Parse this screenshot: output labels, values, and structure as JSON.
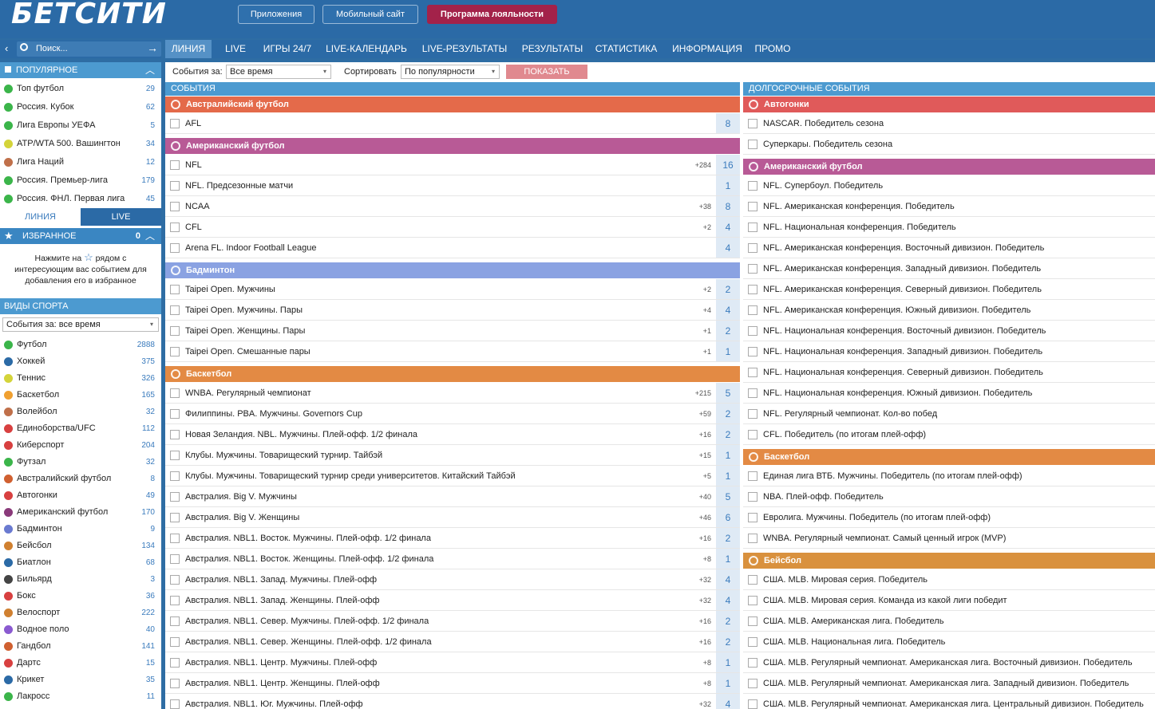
{
  "header": {
    "logo": "БЕТСИТИ",
    "buttons": [
      "Приложения",
      "Мобильный сайт",
      "Программа лояльности"
    ]
  },
  "nav": {
    "tabs": [
      "ЛИНИЯ",
      "LIVE",
      "ИГРЫ 24/7",
      "LIVE-КАЛЕНДАРЬ",
      "LIVE-РЕЗУЛЬТАТЫ",
      "РЕЗУЛЬТАТЫ",
      "СТАТИСТИКА",
      "ИНФОРМАЦИЯ",
      "ПРОМО"
    ]
  },
  "search": {
    "placeholder": "Поиск..."
  },
  "popular": {
    "title": "ПОПУЛЯРНОЕ",
    "items": [
      {
        "label": "Топ футбол",
        "count": "29",
        "color": "#3bb54a"
      },
      {
        "label": "Россия. Кубок",
        "count": "62",
        "color": "#3bb54a"
      },
      {
        "label": "Лига Европы УЕФА",
        "count": "5",
        "color": "#3bb54a"
      },
      {
        "label": "ATP/WTA 500. Вашингтон",
        "count": "34",
        "color": "#d4d43a"
      },
      {
        "label": "Лига Наций",
        "count": "12",
        "color": "#c0704a"
      },
      {
        "label": "Россия. Премьер-лига",
        "count": "179",
        "color": "#3bb54a"
      },
      {
        "label": "Россия. ФНЛ. Первая лига",
        "count": "45",
        "color": "#3bb54a"
      }
    ]
  },
  "side_tabs": [
    "ЛИНИЯ",
    "LIVE"
  ],
  "favorites": {
    "title": "ИЗБРАННОЕ",
    "count": "0",
    "hint_a": "Нажмите на",
    "hint_b": "рядом с",
    "hint_c": "интересующим вас событием для",
    "hint_d": "добавления его в избранное"
  },
  "sports": {
    "title": "ВИДЫ СПОРТА",
    "filter": "События за: все время",
    "items": [
      {
        "label": "Футбол",
        "count": "2888",
        "color": "#3bb54a"
      },
      {
        "label": "Хоккей",
        "count": "375",
        "color": "#2b6aa6"
      },
      {
        "label": "Теннис",
        "count": "326",
        "color": "#d4d43a"
      },
      {
        "label": "Баскетбол",
        "count": "165",
        "color": "#f0a030"
      },
      {
        "label": "Волейбол",
        "count": "32",
        "color": "#c0704a"
      },
      {
        "label": "Единоборства/UFC",
        "count": "112",
        "color": "#d84040"
      },
      {
        "label": "Киберспорт",
        "count": "204",
        "color": "#d84040"
      },
      {
        "label": "Футзал",
        "count": "32",
        "color": "#3bb54a"
      },
      {
        "label": "Австралийский футбол",
        "count": "8",
        "color": "#d06030"
      },
      {
        "label": "Автогонки",
        "count": "49",
        "color": "#d84040"
      },
      {
        "label": "Американский футбол",
        "count": "170",
        "color": "#8a3a7a"
      },
      {
        "label": "Бадминтон",
        "count": "9",
        "color": "#6a7ad0"
      },
      {
        "label": "Бейсбол",
        "count": "134",
        "color": "#d08030"
      },
      {
        "label": "Биатлон",
        "count": "68",
        "color": "#2b6aa6"
      },
      {
        "label": "Бильярд",
        "count": "3",
        "color": "#444444"
      },
      {
        "label": "Бокс",
        "count": "36",
        "color": "#d84040"
      },
      {
        "label": "Велоспорт",
        "count": "222",
        "color": "#d08030"
      },
      {
        "label": "Водное поло",
        "count": "40",
        "color": "#8a5ad0"
      },
      {
        "label": "Гандбол",
        "count": "141",
        "color": "#d06030"
      },
      {
        "label": "Дартс",
        "count": "15",
        "color": "#d84040"
      },
      {
        "label": "Крикет",
        "count": "35",
        "color": "#2b6aa6"
      },
      {
        "label": "Лакросс",
        "count": "11",
        "color": "#3bb54a"
      }
    ]
  },
  "filters": {
    "events_label": "События за:",
    "events_value": "Все время",
    "sort_label": "Сортировать",
    "sort_value": "По популярности",
    "show": "ПОКАЗАТЬ"
  },
  "events": {
    "title": "СОБЫТИЯ",
    "groups": [
      {
        "name": "Австралийский футбол",
        "color": "#e46a4a",
        "rows": [
          {
            "label": "AFL",
            "plus": "",
            "num": "8"
          }
        ]
      },
      {
        "name": "Американский футбол",
        "color": "#b85a96",
        "rows": [
          {
            "label": "NFL",
            "plus": "+284",
            "num": "16"
          },
          {
            "label": "NFL. Предсезонные матчи",
            "plus": "",
            "num": "1"
          },
          {
            "label": "NCAA",
            "plus": "+38",
            "num": "8"
          },
          {
            "label": "CFL",
            "plus": "+2",
            "num": "4"
          },
          {
            "label": "Arena FL. Indoor Football League",
            "plus": "",
            "num": "4"
          }
        ]
      },
      {
        "name": "Бадминтон",
        "color": "#8aa2e2",
        "rows": [
          {
            "label": "Taipei Open. Мужчины",
            "plus": "+2",
            "num": "2"
          },
          {
            "label": "Taipei Open. Мужчины. Пары",
            "plus": "+4",
            "num": "4"
          },
          {
            "label": "Taipei Open. Женщины. Пары",
            "plus": "+1",
            "num": "2"
          },
          {
            "label": "Taipei Open. Смешанные пары",
            "plus": "+1",
            "num": "1"
          }
        ]
      },
      {
        "name": "Баскетбол",
        "color": "#e38a44",
        "rows": [
          {
            "label": "WNBA. Регулярный чемпионат",
            "plus": "+215",
            "num": "5"
          },
          {
            "label": "Филиппины. PBA. Мужчины. Governors Cup",
            "plus": "+59",
            "num": "2"
          },
          {
            "label": "Новая Зеландия. NBL. Мужчины. Плей-офф. 1/2 финала",
            "plus": "+16",
            "num": "2"
          },
          {
            "label": "Клубы. Мужчины. Товарищеский турнир. Тайбэй",
            "plus": "+15",
            "num": "1"
          },
          {
            "label": "Клубы. Мужчины. Товарищеский турнир среди университетов. Китайский Тайбэй",
            "plus": "+5",
            "num": "1"
          },
          {
            "label": "Австралия. Big V. Мужчины",
            "plus": "+40",
            "num": "5"
          },
          {
            "label": "Австралия. Big V. Женщины",
            "plus": "+46",
            "num": "6"
          },
          {
            "label": "Австралия. NBL1. Восток. Мужчины. Плей-офф. 1/2 финала",
            "plus": "+16",
            "num": "2"
          },
          {
            "label": "Австралия. NBL1. Восток. Женщины. Плей-офф. 1/2 финала",
            "plus": "+8",
            "num": "1"
          },
          {
            "label": "Австралия. NBL1. Запад. Мужчины. Плей-офф",
            "plus": "+32",
            "num": "4"
          },
          {
            "label": "Австралия. NBL1. Запад. Женщины. Плей-офф",
            "plus": "+32",
            "num": "4"
          },
          {
            "label": "Австралия. NBL1. Север. Мужчины. Плей-офф. 1/2 финала",
            "plus": "+16",
            "num": "2"
          },
          {
            "label": "Австралия. NBL1. Север. Женщины. Плей-офф. 1/2 финала",
            "plus": "+16",
            "num": "2"
          },
          {
            "label": "Австралия. NBL1. Центр. Мужчины. Плей-офф",
            "plus": "+8",
            "num": "1"
          },
          {
            "label": "Австралия. NBL1. Центр. Женщины. Плей-офф",
            "plus": "+8",
            "num": "1"
          },
          {
            "label": "Австралия. NBL1. Юг. Мужчины. Плей-офф",
            "plus": "+32",
            "num": "4"
          }
        ]
      }
    ]
  },
  "longterm": {
    "title": "ДОЛГОСРОЧНЫЕ СОБЫТИЯ",
    "groups": [
      {
        "name": "Автогонки",
        "color": "#e05a5a",
        "rows": [
          "NASCAR. Победитель сезона",
          "Суперкары. Победитель сезона"
        ]
      },
      {
        "name": "Американский футбол",
        "color": "#b85a96",
        "rows": [
          "NFL. Супербоул. Победитель",
          "NFL. Американская конференция. Победитель",
          "NFL. Национальная конференция. Победитель",
          "NFL. Американская конференция. Восточный дивизион. Победитель",
          "NFL. Американская конференция. Западный дивизион. Победитель",
          "NFL. Американская конференция. Северный дивизион. Победитель",
          "NFL. Американская конференция. Южный дивизион. Победитель",
          "NFL. Национальная конференция. Восточный дивизион. Победитель",
          "NFL. Национальная конференция. Западный дивизион. Победитель",
          "NFL. Национальная конференция. Северный дивизион. Победитель",
          "NFL. Национальная конференция. Южный дивизион. Победитель",
          "NFL. Регулярный чемпионат. Кол-во побед",
          "CFL. Победитель (по итогам плей-офф)"
        ]
      },
      {
        "name": "Баскетбол",
        "color": "#e38a44",
        "rows": [
          "Единая лига ВТБ. Мужчины. Победитель (по итогам плей-офф)",
          "NBA. Плей-офф. Победитель",
          "Евролига. Мужчины. Победитель (по итогам плей-офф)",
          "WNBA. Регулярный чемпионат. Самый ценный игрок (MVP)"
        ]
      },
      {
        "name": "Бейсбол",
        "color": "#d9913e",
        "rows": [
          "США. MLB. Мировая серия. Победитель",
          "США. MLB. Мировая серия. Команда из какой лиги победит",
          "США. MLB. Американская лига. Победитель",
          "США. MLB. Национальная лига. Победитель",
          "США. MLB. Регулярный чемпионат. Американская лига. Восточный дивизион. Победитель",
          "США. MLB. Регулярный чемпионат. Американская лига. Западный дивизион. Победитель",
          "США. MLB. Регулярный чемпионат. Американская лига. Центральный дивизион. Победитель"
        ]
      }
    ]
  }
}
